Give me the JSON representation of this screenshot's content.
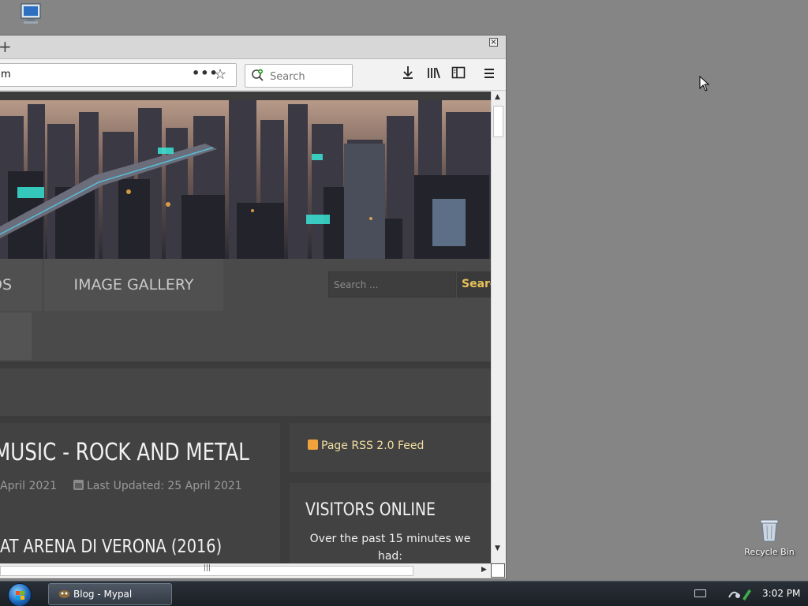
{
  "desktop": {
    "icons": {
      "recycle_bin": "Recycle Bin"
    }
  },
  "browser": {
    "close_glyph": "×",
    "tab_new_glyph": "+",
    "url_fragment": "m",
    "page_actions_glyph": "•••",
    "search_placeholder": "Search",
    "toolbar": {
      "download_icon": "download-icon",
      "library_icon": "library-icon",
      "sidebar_icon": "sidebar-icon",
      "menu_icon": "hamburger-menu-icon"
    }
  },
  "page": {
    "nav": {
      "prev_item_label": "OS",
      "gallery_label": "IMAGE GALLERY"
    },
    "search": {
      "placeholder": "Search ...",
      "button_label": "Search"
    },
    "article": {
      "title": "MUSIC - ROCK AND METAL",
      "created": "April 2021",
      "updated": "Last Updated: 25 April 2021",
      "subtitle": "AT ARENA DI VERONA (2016)"
    },
    "sidebar": {
      "rss_label": "Page RSS 2.0 Feed",
      "visitors_title": "VISITORS ONLINE",
      "visitors_text": "Over the past 15 minutes we had:"
    }
  },
  "taskbar": {
    "window_button": "Blog - Mypal",
    "clock": "3:02 PM"
  },
  "colors": {
    "desktop": "#858585",
    "page_bg": "#3c3c3c",
    "accent_gold": "#e8c15a",
    "rss_orange": "#f0a33a"
  }
}
